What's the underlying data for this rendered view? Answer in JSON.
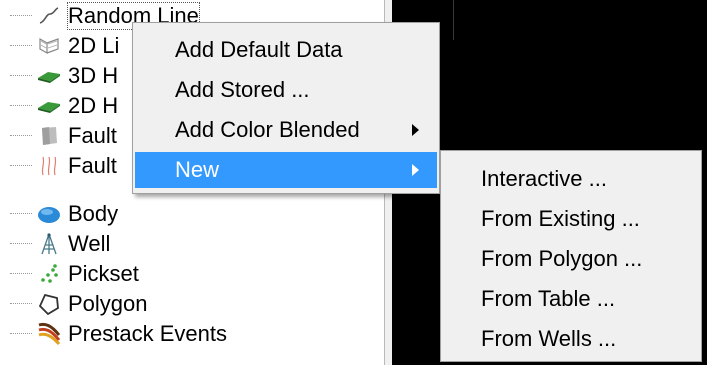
{
  "tree": {
    "items": [
      {
        "label": "Random Line",
        "icon": "random-line-icon"
      },
      {
        "label": "2D Li",
        "icon": "2d-line-icon"
      },
      {
        "label": "3D H",
        "icon": "3d-horizon-icon"
      },
      {
        "label": "2D H",
        "icon": "2d-horizon-icon"
      },
      {
        "label": "Fault",
        "icon": "fault-icon"
      },
      {
        "label": "Fault",
        "icon": "faultstickset-icon"
      },
      {
        "label": "Body",
        "icon": "body-icon"
      },
      {
        "label": "Well",
        "icon": "well-icon"
      },
      {
        "label": "Pickset",
        "icon": "pickset-icon"
      },
      {
        "label": "Polygon",
        "icon": "polygon-icon"
      },
      {
        "label": "Prestack Events",
        "icon": "prestack-events-icon"
      }
    ]
  },
  "context_menu": {
    "items": [
      {
        "label": "Add Default Data",
        "has_submenu": false
      },
      {
        "label": "Add Stored ...",
        "has_submenu": false
      },
      {
        "label": "Add Color Blended",
        "has_submenu": true
      },
      {
        "label": "New",
        "has_submenu": true,
        "highlighted": true
      }
    ]
  },
  "submenu": {
    "items": [
      {
        "label": "Interactive ..."
      },
      {
        "label": "From Existing ..."
      },
      {
        "label": "From Polygon ..."
      },
      {
        "label": "From Table ..."
      },
      {
        "label": "From Wells ..."
      }
    ]
  },
  "colors": {
    "highlight": "#3399ff",
    "menu_bg": "#f0f0f0",
    "viewer_bg": "#000000",
    "horizon_green": "#3a9a3a",
    "body_blue": "#2a8ad8"
  }
}
